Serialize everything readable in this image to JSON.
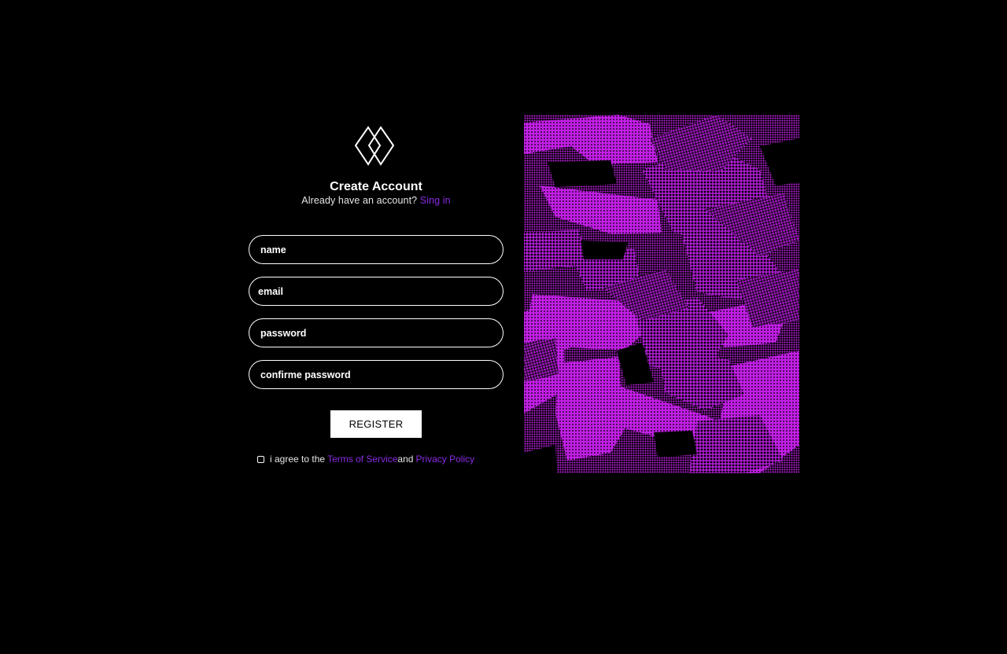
{
  "brand": {
    "logo_icon": "diamond-logo-icon",
    "accent_color": "#8a2be2",
    "art_color": "#c21fe6"
  },
  "form": {
    "title": "Create Account",
    "subtitle_text": "Already have an account?",
    "signin_link": "Sing in",
    "name_placeholder": "name",
    "email_placeholder": "email",
    "password_placeholder": "password",
    "confirm_placeholder": "confirme password",
    "register_label": "REGISTER",
    "agree_text": "i agree to the",
    "terms_link": "Terms of Service",
    "and_text": "and",
    "privacy_link": "Privacy Policy"
  }
}
